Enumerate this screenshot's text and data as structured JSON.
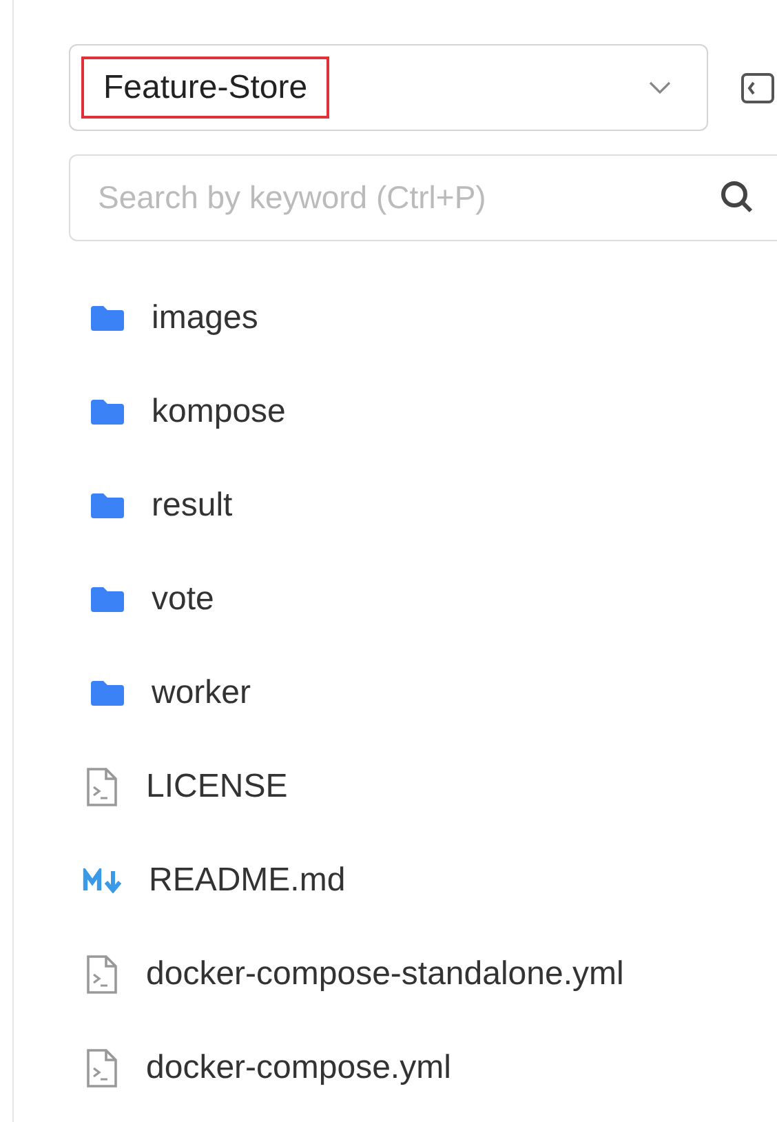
{
  "branch_selector": {
    "value": "Feature-Store",
    "highlighted": true
  },
  "search": {
    "placeholder": "Search by keyword (Ctrl+P)"
  },
  "files": [
    {
      "name": "images",
      "kind": "folder"
    },
    {
      "name": "kompose",
      "kind": "folder"
    },
    {
      "name": "result",
      "kind": "folder"
    },
    {
      "name": "vote",
      "kind": "folder"
    },
    {
      "name": "worker",
      "kind": "folder"
    },
    {
      "name": "LICENSE",
      "kind": "file"
    },
    {
      "name": "README.md",
      "kind": "markdown"
    },
    {
      "name": "docker-compose-standalone.yml",
      "kind": "file"
    },
    {
      "name": "docker-compose.yml",
      "kind": "file"
    }
  ]
}
